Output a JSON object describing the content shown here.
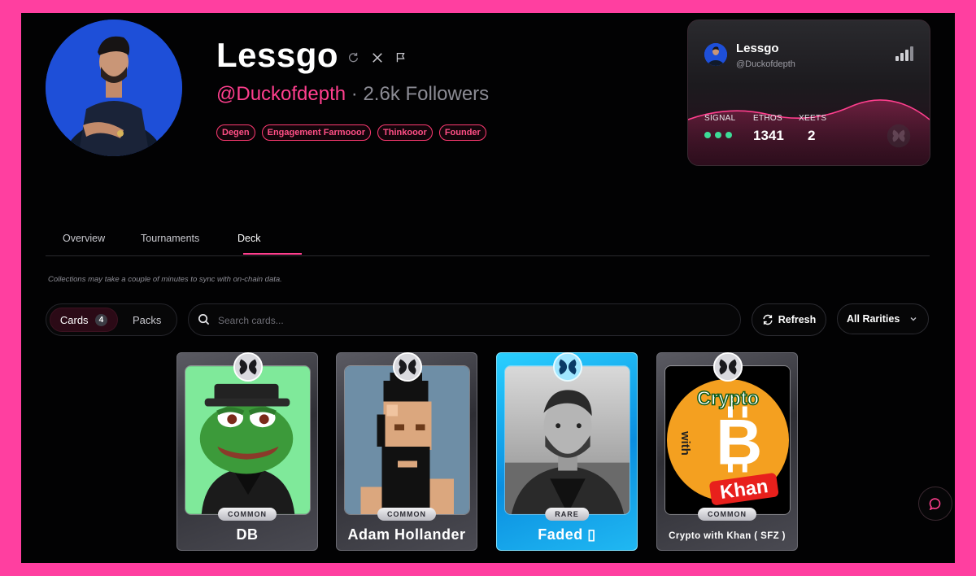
{
  "profile": {
    "name": "Lessgo",
    "handle": "@Duckofdepth",
    "followers_sep": " · ",
    "followers": "2.6k Followers",
    "tags": [
      "Degen",
      "Engagement Farmooor",
      "Thinkooor",
      "Founder"
    ],
    "icons": [
      "refresh-icon",
      "x-logo-icon",
      "flag-icon"
    ]
  },
  "stats_card": {
    "name": "Lessgo",
    "handle": "@Duckofdepth",
    "signal_label": "SIGNAL",
    "signal_level": 3,
    "ethos_label": "ETHOS",
    "ethos_value": "1341",
    "xeets_label": "XEETS",
    "xeets_value": "2",
    "colors": {
      "signal_dot": "#3ddc97",
      "wave": "#ff3f8e"
    }
  },
  "tabs": [
    {
      "label": "Overview",
      "active": false
    },
    {
      "label": "Tournaments",
      "active": false
    },
    {
      "label": "Deck",
      "active": true
    }
  ],
  "notice": "Collections may take a couple of minutes to sync with on-chain data.",
  "controls": {
    "cards_label": "Cards",
    "cards_count": "4",
    "packs_label": "Packs",
    "search_placeholder": "Search cards...",
    "refresh_label": "Refresh",
    "rarity_selected": "All Rarities"
  },
  "cards": [
    {
      "name": "DB",
      "rarity": "COMMON",
      "art": "pepe-frog"
    },
    {
      "name": "Adam Hollander",
      "rarity": "COMMON",
      "art": "pixel-punk"
    },
    {
      "name": "Faded ▯",
      "rarity": "RARE",
      "art": "bw-portrait"
    },
    {
      "name": "Crypto with Khan ( SFZ )",
      "rarity": "COMMON",
      "art": "bitcoin-logo"
    }
  ],
  "card_art_text": {
    "crypto": "Crypto",
    "with": "with",
    "khan": "Khan"
  },
  "colors": {
    "accent": "#ff3f8e",
    "frame": "#ff3fa0",
    "background": "#020203",
    "rare": "#1aa8f0"
  }
}
